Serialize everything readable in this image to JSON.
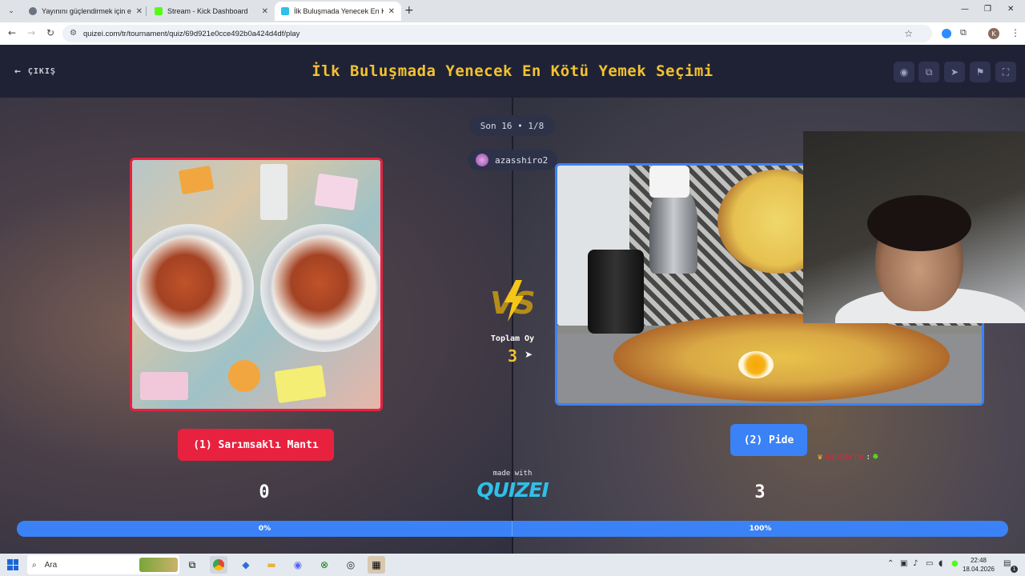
{
  "browser": {
    "tabs": [
      {
        "title": "Yayınını güçlendirmek için en iyi",
        "active": false
      },
      {
        "title": "Stream - Kick Dashboard",
        "active": false
      },
      {
        "title": "İlk Buluşmada Yenecek En Kötü",
        "active": true
      }
    ],
    "url": "quizei.com/tr/tournament/quiz/69d921e0cce492b0a424d4df/play",
    "profile_initial": "K"
  },
  "header": {
    "exit_label": "ÇIKIŞ",
    "title": "İlk Buluşmada Yenecek En Kötü Yemek Seçimi",
    "icons": [
      "eye-icon",
      "copy-icon",
      "send-icon",
      "flag-icon",
      "fullscreen-icon"
    ]
  },
  "round": {
    "label": "Son 16 • 1/8",
    "streamer": "azasshiro2"
  },
  "options": {
    "left": {
      "label": "(1) Sarımsaklı Mantı",
      "votes": "0",
      "percent_label": "0%",
      "percent": 0
    },
    "right": {
      "label": "(2) Pide",
      "votes": "3",
      "percent_label": "100%",
      "percent": 100
    }
  },
  "total": {
    "label": "Toplam Oy",
    "value": "3"
  },
  "branding": {
    "made_with": "made with",
    "logo": "QUIZEI"
  },
  "chat": {
    "user": "Santerrw",
    "separator": ":",
    "user_color": "#e8213f"
  },
  "colors": {
    "accent": "#f2c230",
    "left": "#e8213f",
    "right": "#3b82f6"
  },
  "taskbar": {
    "search_placeholder": "Ara",
    "time": "22:48",
    "date": "18.04.2026",
    "notification_count": "1"
  }
}
